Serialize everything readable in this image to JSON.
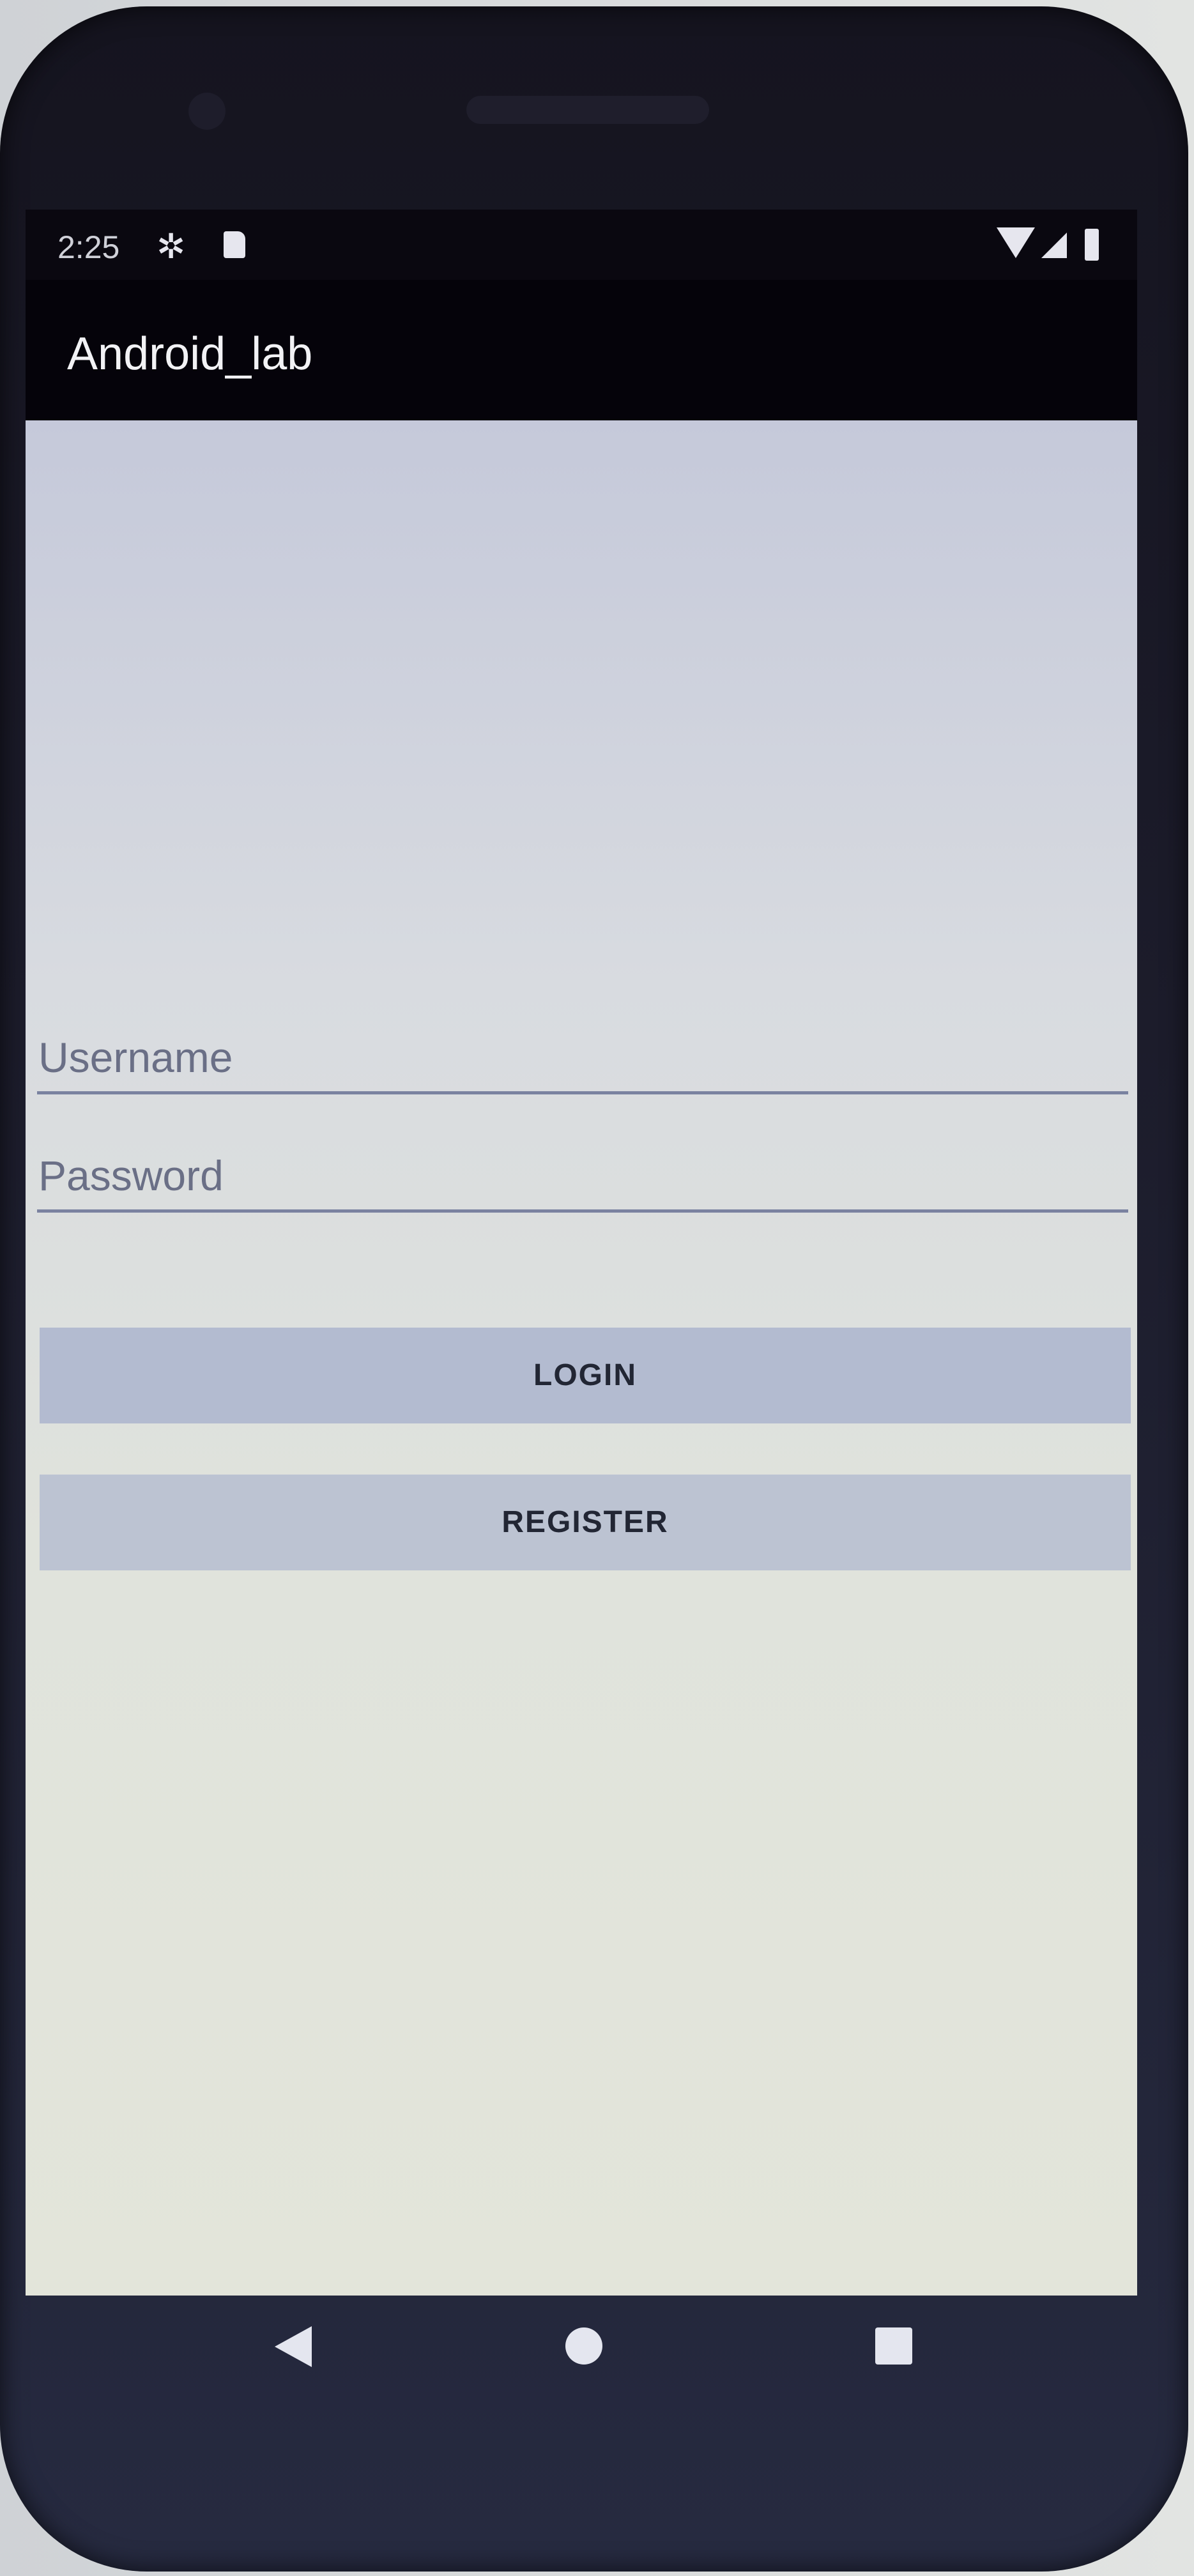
{
  "status_bar": {
    "time": "2:25",
    "icons": [
      "settings-gear-icon",
      "sd-card-icon",
      "wifi-icon",
      "cell-signal-icon",
      "battery-icon"
    ]
  },
  "app_bar": {
    "title": "Android_lab"
  },
  "form": {
    "username_placeholder": "Username",
    "password_placeholder": "Password",
    "username_value": "",
    "password_value": ""
  },
  "buttons": {
    "login_label": "LOGIN",
    "register_label": "REGISTER"
  },
  "nav_bar": {
    "icons": [
      "back-icon",
      "home-icon",
      "recents-icon"
    ]
  },
  "colors": {
    "app_bar": "#05030a",
    "button": "#b3bbd0",
    "underline": "#7a82a0"
  }
}
